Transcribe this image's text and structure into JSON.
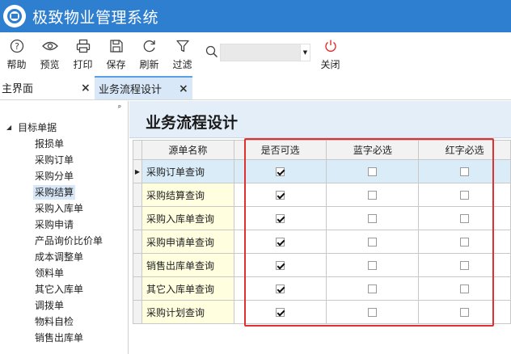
{
  "app": {
    "title": "极致物业管理系统"
  },
  "toolbar": {
    "buttons": [
      {
        "label": "帮助",
        "icon": "help-icon"
      },
      {
        "label": "预览",
        "icon": "eye-icon"
      },
      {
        "label": "打印",
        "icon": "printer-icon"
      },
      {
        "label": "保存",
        "icon": "save-icon"
      },
      {
        "label": "刷新",
        "icon": "refresh-icon"
      },
      {
        "label": "过滤",
        "icon": "filter-icon"
      }
    ],
    "search_value": "",
    "close_label": "关闭",
    "close_color": "#e03030"
  },
  "tabs": [
    {
      "label": "主界面",
      "close": "×"
    },
    {
      "label": "业务流程设计",
      "close": "×"
    }
  ],
  "tree": {
    "pin": "ᵖ",
    "root_arrow": "◢",
    "root": "目标单据",
    "items": [
      "报损单",
      "采购订单",
      "采购分单",
      "采购结算",
      "采购入库单",
      "采购申请",
      "产品询价比价单",
      "成本调整单",
      "领料单",
      "其它入库单",
      "调拨单",
      "物料自检",
      "销售出库单"
    ],
    "selected": "采购结算"
  },
  "page": {
    "title": "业务流程设计"
  },
  "grid": {
    "columns": [
      "源单名称",
      "是否可选",
      "蓝字必选",
      "红字必选"
    ],
    "current_marker": "▶",
    "rows": [
      {
        "name": "采购订单查询",
        "optional": true,
        "blue": false,
        "red": false
      },
      {
        "name": "采购结算查询",
        "optional": true,
        "blue": false,
        "red": false
      },
      {
        "name": "采购入库单查询",
        "optional": true,
        "blue": false,
        "red": false
      },
      {
        "name": "采购申请单查询",
        "optional": true,
        "blue": false,
        "red": false
      },
      {
        "name": "销售出库单查询",
        "optional": true,
        "blue": false,
        "red": false
      },
      {
        "name": "其它入库单查询",
        "optional": true,
        "blue": false,
        "red": false
      },
      {
        "name": "采购计划查询",
        "optional": true,
        "blue": false,
        "red": false
      }
    ]
  },
  "colors": {
    "titlebar": "#2f7fd0",
    "highlight_box": "#e03030",
    "name_cell": "#ffffe0"
  }
}
